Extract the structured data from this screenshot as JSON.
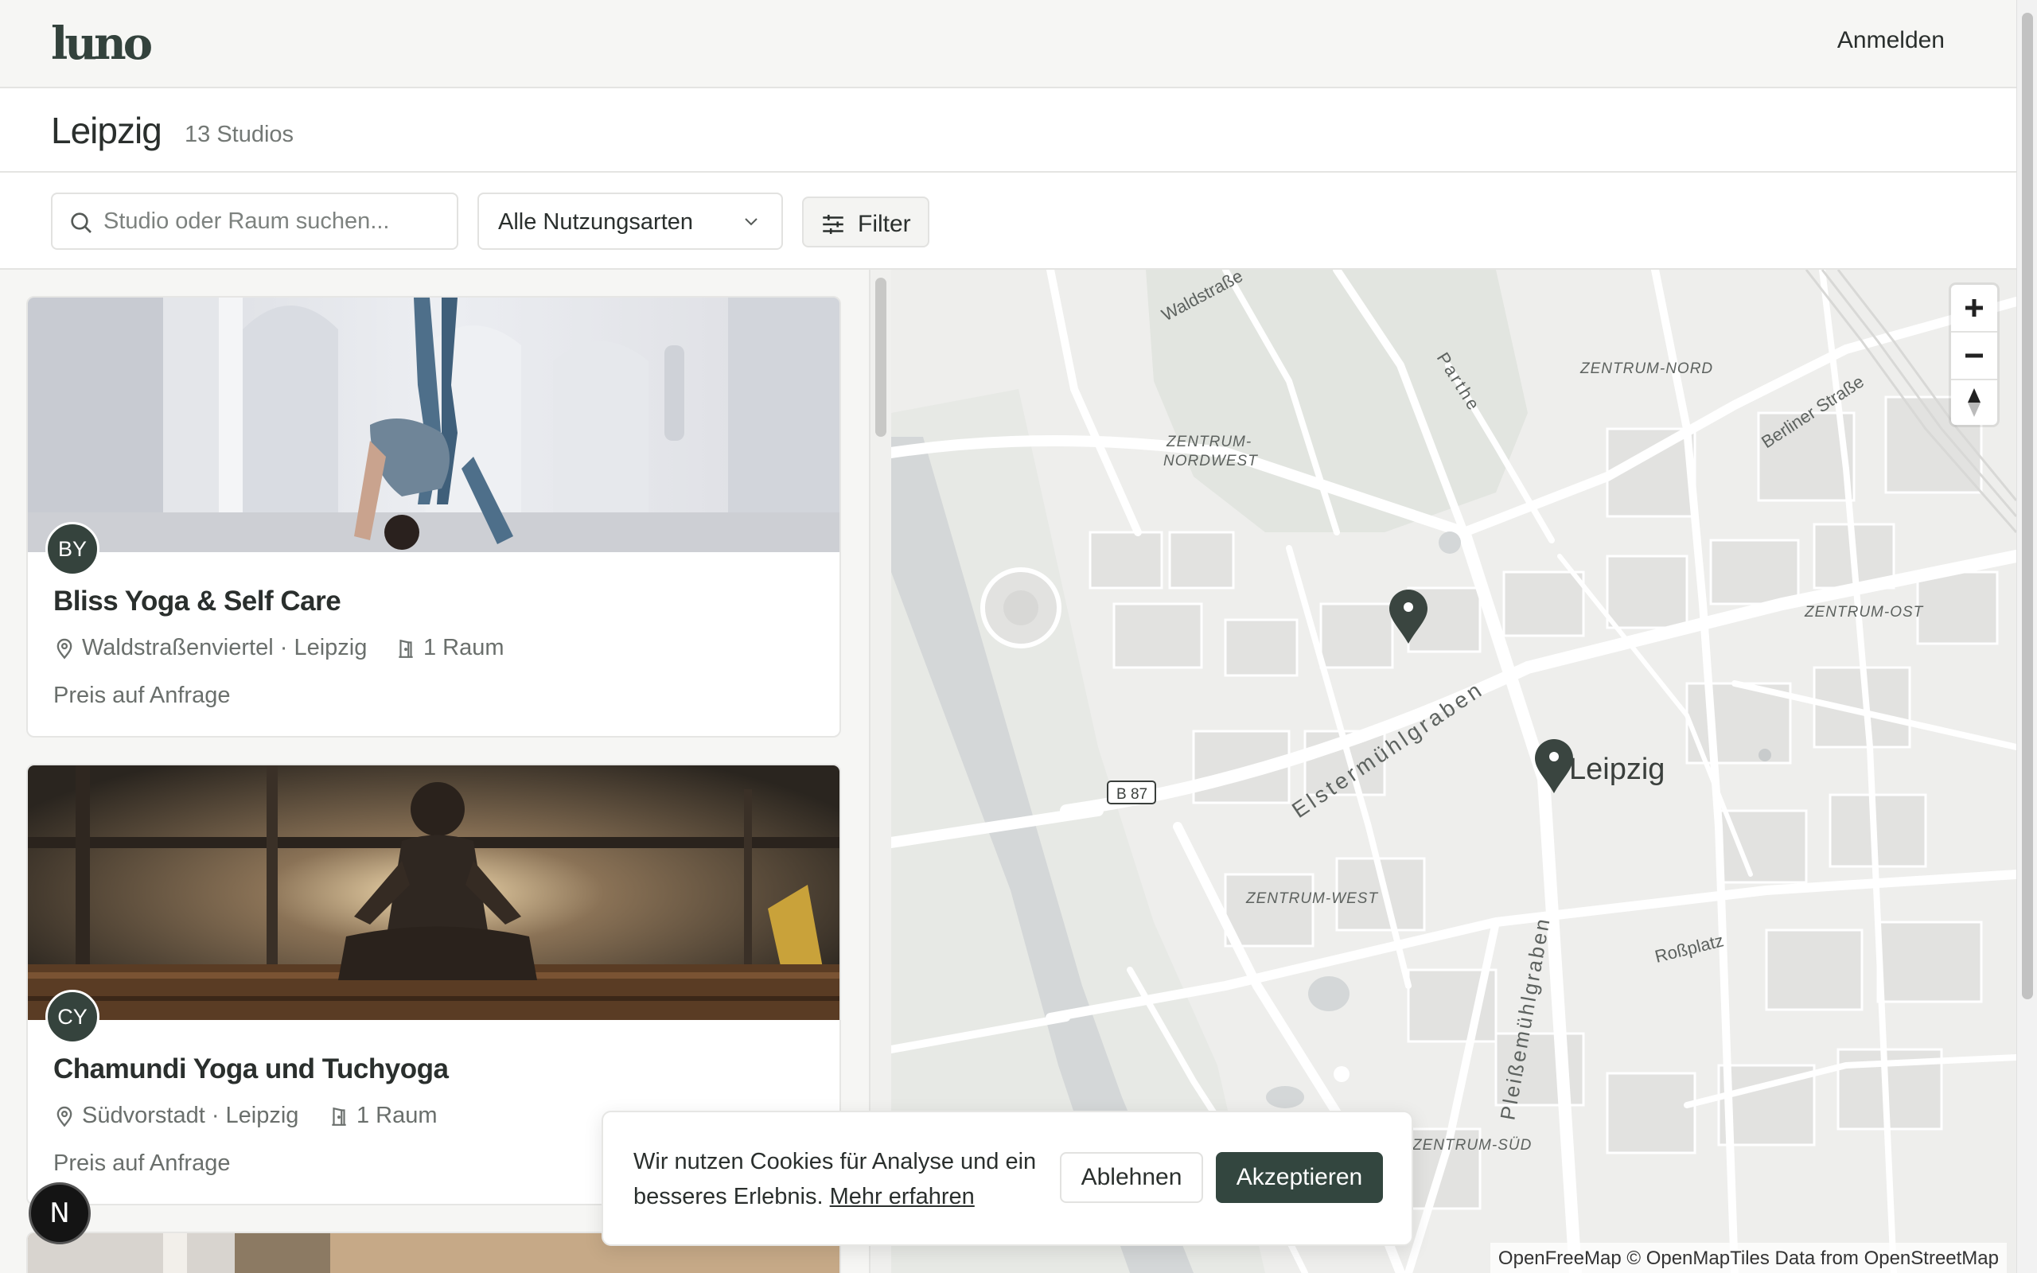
{
  "header": {
    "logo": "luno",
    "signin_label": "Anmelden"
  },
  "titlebar": {
    "city": "Leipzig",
    "count": "13 Studios"
  },
  "filters": {
    "search_placeholder": "Studio oder Raum suchen...",
    "usage_select": "Alle Nutzungsarten",
    "filter_label": "Filter"
  },
  "studios": [
    {
      "initials": "BY",
      "name": "Bliss Yoga & Self Care",
      "location": "Waldstraßenviertel · Leipzig",
      "rooms": "1 Raum",
      "price": "Preis auf Anfrage"
    },
    {
      "initials": "CY",
      "name": "Chamundi Yoga und Tuchyoga",
      "location": "Südvorstadt · Leipzig",
      "rooms": "1 Raum",
      "price": "Preis auf Anfrage"
    }
  ],
  "map": {
    "labels": {
      "waldstrasse": "Waldstraße",
      "parthe": "Parthe",
      "zentrum_nord": "ZENTRUM-NORD",
      "berliner": "Berliner Straße",
      "zn_west_1": "ZENTRUM-",
      "zn_west_2": "NORDWEST",
      "zentrum_ost": "ZENTRUM-OST",
      "elster": "Elstermühlgraben",
      "b87": "B 87",
      "leipzig": "Leipzig",
      "zentrum_west": "ZENTRUM-WEST",
      "rossplatz": "Roßplatz",
      "pleisse": "Pleißemühlgraben",
      "zentrum_sued": "ZENTRUM-SÜD"
    },
    "attribution": "OpenFreeMap © OpenMapTiles Data from OpenStreetMap"
  },
  "cookie": {
    "text": "Wir nutzen Cookies für Analyse und ein besseres Erlebnis.",
    "link": "Mehr erfahren",
    "decline": "Ablehnen",
    "accept": "Akzeptieren"
  },
  "badge": {
    "letter": "N"
  },
  "colors": {
    "accent": "#33463f",
    "marker": "#3a4540",
    "map_bg": "#eeeeec",
    "road": "#ffffff",
    "park": "#dfe3de"
  }
}
